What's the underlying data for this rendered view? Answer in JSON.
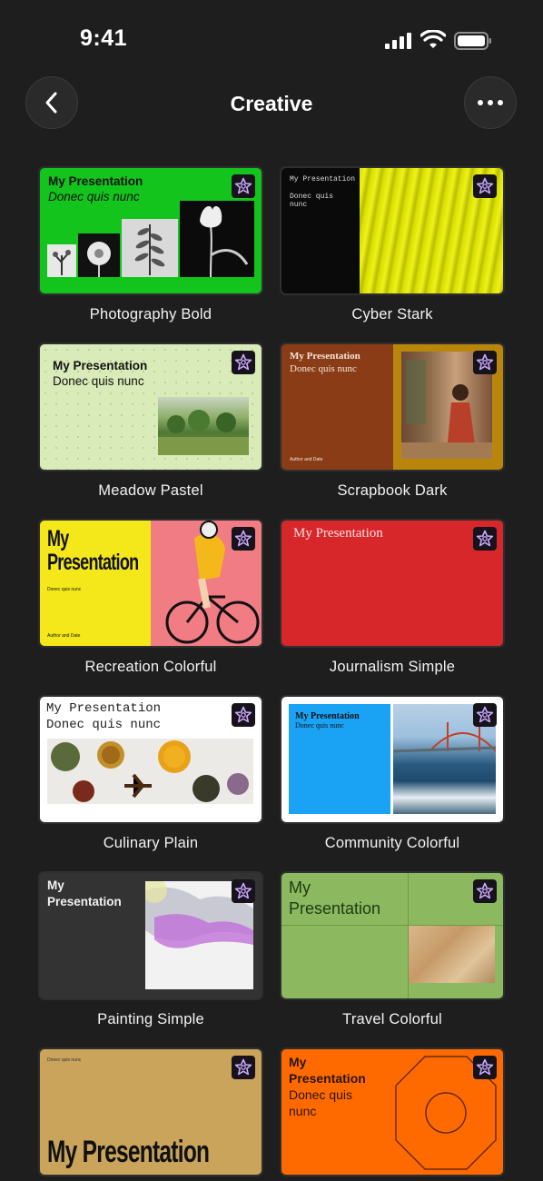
{
  "status_bar": {
    "time": "9:41"
  },
  "header": {
    "title": "Creative"
  },
  "templates": [
    {
      "name": "Photography Bold",
      "heading": "My Presentation",
      "subheading": "Donec quis nunc"
    },
    {
      "name": "Cyber Stark",
      "heading": "My Presentation",
      "subheading": "Donec quis nunc"
    },
    {
      "name": "Meadow Pastel",
      "heading": "My Presentation",
      "subheading": "Donec quis nunc"
    },
    {
      "name": "Scrapbook Dark",
      "heading": "My Presentation",
      "subheading": "Donec quis nunc",
      "footer": "Author and Date"
    },
    {
      "name": "Recreation Colorful",
      "heading_line1": "My",
      "heading_line2": "Presentation",
      "subheading": "Donec quis nunc",
      "footer": "Author and Date"
    },
    {
      "name": "Journalism Simple",
      "heading": "My Presentation"
    },
    {
      "name": "Culinary Plain",
      "heading": "My Presentation",
      "subheading": "Donec quis nunc"
    },
    {
      "name": "Community Colorful",
      "heading": "My Presentation",
      "subheading": "Donec quis nunc"
    },
    {
      "name": "Painting Simple",
      "heading_line1": "My",
      "heading_line2": "Presentation"
    },
    {
      "name": "Travel Colorful",
      "heading_line1": "My",
      "heading_line2": "Presentation"
    },
    {
      "name": "",
      "heading": "My Presentation",
      "subheading": "Donec quis nunc"
    },
    {
      "name": "",
      "heading_line1": "My",
      "heading_line2": "Presentation",
      "subheading_line1": "Donec quis",
      "subheading_line2": "nunc"
    }
  ],
  "colors": {
    "background": "#1e1e1f",
    "photography_green": "#12c41c",
    "cyber_yellow": "#d9e000",
    "meadow_green": "#d8ebb8",
    "scrapbook_brown": "#8a3c16",
    "recreation_yellow": "#f4e81a",
    "recreation_pink": "#f27c84",
    "journalism_red": "#d8272b",
    "community_blue": "#1aa3f5",
    "travel_green": "#8cb860",
    "gold": "#c9a45a",
    "orange": "#ff6a00"
  },
  "icons": {
    "back": "chevron-left-icon",
    "more": "ellipsis-icon",
    "badge": "sparkle-star-icon"
  }
}
